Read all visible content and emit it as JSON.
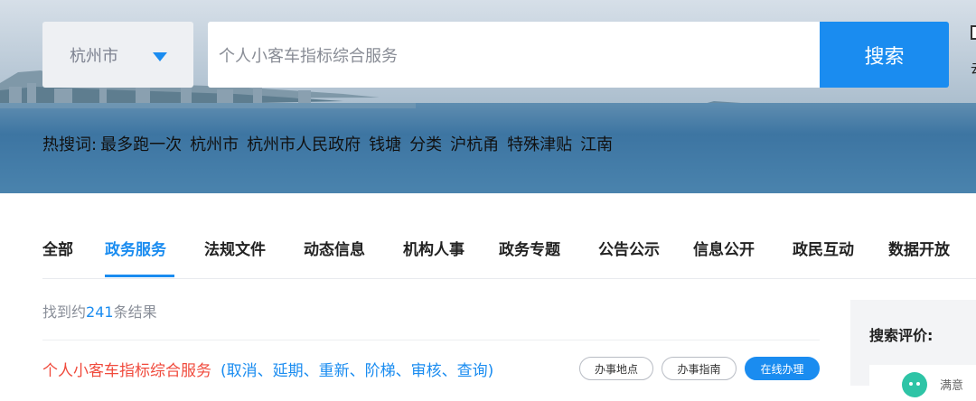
{
  "search": {
    "city": "杭州市",
    "query": "个人小客车指标综合服务",
    "button_label": "搜索",
    "edge_char": "云"
  },
  "hot_searches": {
    "label": "热搜词:",
    "words": [
      "最多跑一次",
      "杭州市",
      "杭州市人民政府",
      "钱塘",
      "分类",
      "沪杭甬",
      "特殊津贴",
      "江南"
    ]
  },
  "tabs": [
    {
      "label": "全部"
    },
    {
      "label": "政务服务",
      "active": true
    },
    {
      "label": "法规文件"
    },
    {
      "label": "动态信息"
    },
    {
      "label": "机构人事"
    },
    {
      "label": "政务专题"
    },
    {
      "label": "公告公示"
    },
    {
      "label": "信息公开"
    },
    {
      "label": "政民互动"
    },
    {
      "label": "数据开放"
    }
  ],
  "results": {
    "count_prefix": "找到约",
    "count": "241",
    "count_suffix": "条结果",
    "items": [
      {
        "title": "个人小客车指标综合服务",
        "subtitle": "(取消、延期、重新、阶梯、审核、查询)",
        "actions": [
          "办事地点",
          "办事指南",
          "在线办理"
        ]
      }
    ]
  },
  "side_panel": {
    "title": "搜索评价:",
    "card_text": "满意"
  },
  "colors": {
    "accent": "#1a8cf0",
    "result_title": "#f04a3c",
    "avatar": "#2ec4a6"
  }
}
